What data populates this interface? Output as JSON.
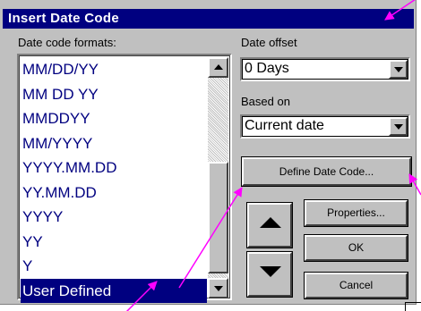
{
  "dialog": {
    "title": "Insert Date Code"
  },
  "formats_label": "Date code formats:",
  "formats": [
    "MM/DD/YY",
    "MM DD YY",
    "MMDDYY",
    "MM/YYYY",
    "YYYY.MM.DD",
    "YY.MM.DD",
    "YYYY",
    "YY",
    "Y",
    "User Defined"
  ],
  "selected_format": "User Defined",
  "date_offset": {
    "label": "Date offset",
    "value": "0 Days"
  },
  "based_on": {
    "label": "Based on",
    "value": "Current date"
  },
  "buttons": {
    "define": "Define Date Code...",
    "properties": "Properties...",
    "ok": "OK",
    "cancel": "Cancel"
  },
  "colors": {
    "title_bar": "#000080",
    "dialog_face": "#c0c0c0",
    "list_text": "#000080",
    "selection": "#000080",
    "annotation_arrows": "#ff00ff"
  }
}
